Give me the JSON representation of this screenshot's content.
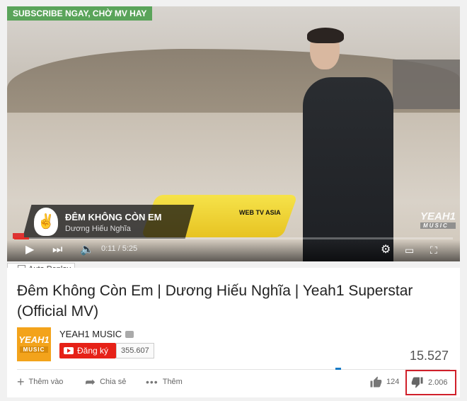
{
  "video": {
    "banner": "SUBSCRIBE NGAY, CHỜ MV HAY",
    "lower_third_title": "ĐÊM KHÔNG CÒN EM",
    "lower_third_artist": "Dương Hiếu Nghĩa",
    "lower_third_badge": "WEB TV ASIA",
    "watermark": "YEAH1",
    "watermark_sub": "MUSIC",
    "time": "0:11 / 5:25",
    "progress": 0.034,
    "play_icon": "play-icon",
    "next_icon": "next-icon",
    "volume_icon": "volume-icon",
    "settings_icon": "gear-hd-icon",
    "theater_icon": "theater-icon",
    "fullscreen_icon": "fullscreen-icon"
  },
  "auto_replay": "Auto Replay",
  "info": {
    "title": "Đêm Không Còn Em | Dương Hiếu Nghĩa | Yeah1 Superstar (Official MV)",
    "channel_name": "YEAH1 MUSIC",
    "channel_logo": "YEAH1",
    "channel_logo_sub": "MUSIC",
    "subscribe_label": "Đăng ký",
    "subscriber_count": "355.607",
    "views": "15.527"
  },
  "actions": {
    "add": "Thêm vào",
    "share": "Chia sẻ",
    "more": "Thêm",
    "likes": "124",
    "dislikes": "2.006"
  },
  "colors": {
    "subscribe_red": "#e62117",
    "highlight_border": "#d0202a",
    "banner_green": "#5aa45a"
  }
}
